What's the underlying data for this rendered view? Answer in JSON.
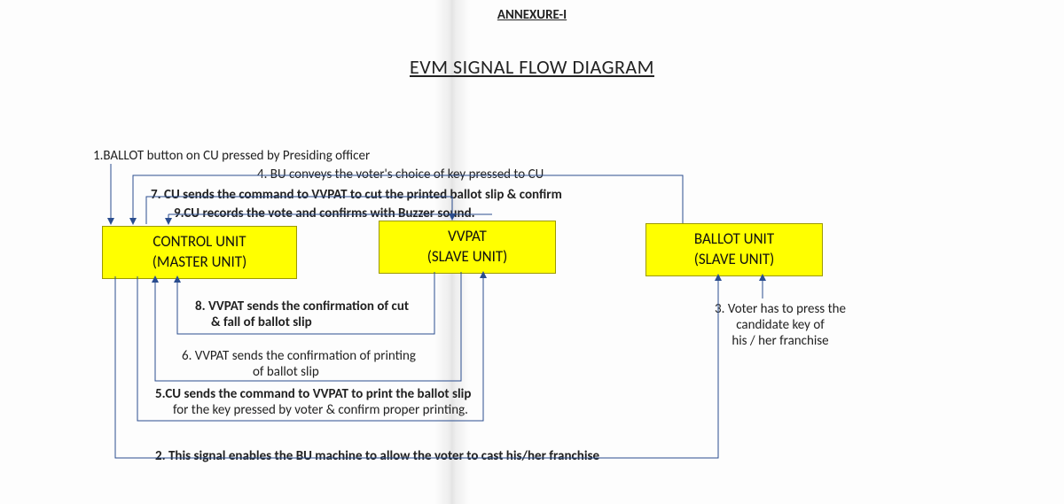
{
  "header": {
    "annexure": "ANNEXURE-I",
    "title": "EVM SIGNAL FLOW DIAGRAM"
  },
  "units": {
    "control": {
      "line1": "CONTROL UNIT",
      "line2": "(MASTER UNIT)"
    },
    "vvpat": {
      "line1": "VVPAT",
      "line2": "(SLAVE UNIT)"
    },
    "ballot": {
      "line1": "BALLOT UNIT",
      "line2": "(SLAVE UNIT)"
    }
  },
  "steps": {
    "s1": "1.BALLOT button on CU pressed by Presiding officer",
    "s2": "2.  This signal enables the BU machine to allow the voter to cast his/her franchise",
    "s3a": "3. Voter has to press the",
    "s3b": "candidate key of",
    "s3c": "his / her franchise",
    "s4": "4. BU conveys the voter's choice of key pressed to CU",
    "s5a": "5.CU sends the command to VVPAT to print the ballot slip",
    "s5b": "for the key pressed by voter & confirm proper printing.",
    "s6a": "6. VVPAT sends the confirmation of printing",
    "s6b": "of ballot slip",
    "s7": "7. CU sends the command to VVPAT to cut the   printed   ballot slip & confirm",
    "s8a": "8. VVPAT sends the confirmation of cut",
    "s8b": "& fall of ballot slip",
    "s9": "9.CU records the vote and confirms with Buzzer sound."
  }
}
